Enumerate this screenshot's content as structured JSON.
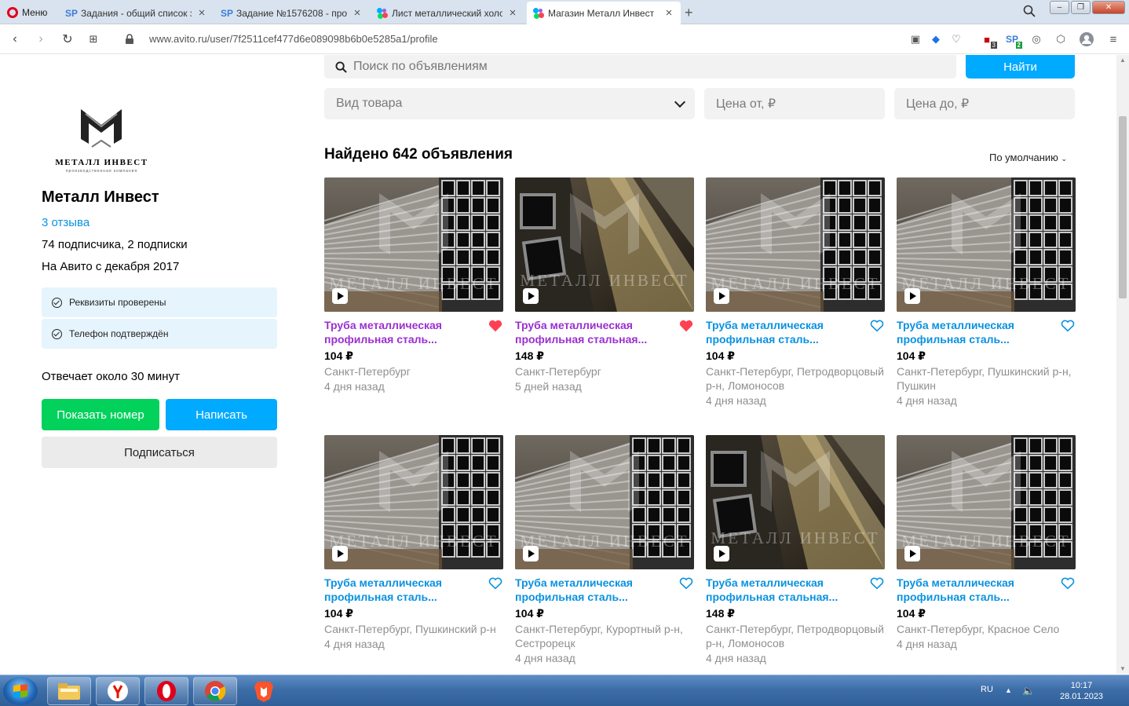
{
  "browser": {
    "menu_label": "Меню",
    "tabs": [
      {
        "title": "Задания - общий список з",
        "favicon": "sp-icon"
      },
      {
        "title": "Задание №1576208 - про",
        "favicon": "sp-icon"
      },
      {
        "title": "Лист металлический холо",
        "favicon": "avito-icon"
      },
      {
        "title": "Магазин Металл Инвест",
        "favicon": "avito-icon",
        "active": true
      }
    ],
    "url": "www.avito.ru/user/7f2511cef477d6e089098b6b0e5285a1/profile",
    "ext_badges": {
      "shield_count": "3",
      "sp_count": "2"
    }
  },
  "sidebar": {
    "logo_text": "МЕТАЛЛ ИНВЕСТ",
    "logo_subtext": "производственная компания",
    "seller_name": "Металл Инвест",
    "reviews": "3 отзыва",
    "subscribers": "74 подписчика, 2 подписки",
    "since": "На Авито с декабря 2017",
    "badges": [
      "Реквизиты проверены",
      "Телефон подтверждён"
    ],
    "response_time": "Отвечает около 30 минут",
    "show_phone": "Показать номер",
    "write": "Написать",
    "subscribe": "Подписаться"
  },
  "search": {
    "placeholder": "Поиск по объявлениям",
    "button": "Найти",
    "category": "Вид товара",
    "price_from": "Цена от, ₽",
    "price_to": "Цена до, ₽"
  },
  "results": {
    "found": "Найдено 642 объявления",
    "sort": "По умолчанию"
  },
  "listings": [
    {
      "title": "Труба металлическая профильная сталь...",
      "price": "104 ₽",
      "location": "Санкт-Петербург",
      "date": "4 дня назад",
      "favorite": true,
      "visited": true,
      "photo": "rows"
    },
    {
      "title": "Труба металлическая профильная стальная...",
      "price": "148 ₽",
      "location": "Санкт-Петербург",
      "date": "5 дней назад",
      "favorite": true,
      "visited": true,
      "photo": "closeup"
    },
    {
      "title": "Труба металлическая профильная сталь...",
      "price": "104 ₽",
      "location": "Санкт-Петербург, Петродворцовый р-н, Ломоносов",
      "date": "4 дня назад",
      "favorite": false,
      "visited": false,
      "photo": "rows"
    },
    {
      "title": "Труба металлическая профильная сталь...",
      "price": "104 ₽",
      "location": "Санкт-Петербург, Пушкинский р-н, Пушкин",
      "date": "4 дня назад",
      "favorite": false,
      "visited": false,
      "photo": "rows"
    },
    {
      "title": "Труба металлическая профильная сталь...",
      "price": "104 ₽",
      "location": "Санкт-Петербург, Пушкинский р-н",
      "date": "4 дня назад",
      "favorite": false,
      "visited": false,
      "photo": "rows"
    },
    {
      "title": "Труба металлическая профильная сталь...",
      "price": "104 ₽",
      "location": "Санкт-Петербург, Курортный р-н, Сестрорецк",
      "date": "4 дня назад",
      "favorite": false,
      "visited": false,
      "photo": "rows"
    },
    {
      "title": "Труба металлическая профильная стальная...",
      "price": "148 ₽",
      "location": "Санкт-Петербург, Петродворцовый р-н, Ломоносов",
      "date": "4 дня назад",
      "favorite": false,
      "visited": false,
      "photo": "closeup"
    },
    {
      "title": "Труба металлическая профильная сталь...",
      "price": "104 ₽",
      "location": "Санкт-Петербург, Красное Село",
      "date": "4 дня назад",
      "favorite": false,
      "visited": false,
      "photo": "rows"
    }
  ],
  "taskbar": {
    "lang": "RU",
    "time": "10:17",
    "date": "28.01.2023"
  },
  "colors": {
    "accent": "#00aaff",
    "green": "#02d15c",
    "link": "#0a92e0",
    "visited": "#9c2fd0",
    "heart": "#ff4053"
  }
}
